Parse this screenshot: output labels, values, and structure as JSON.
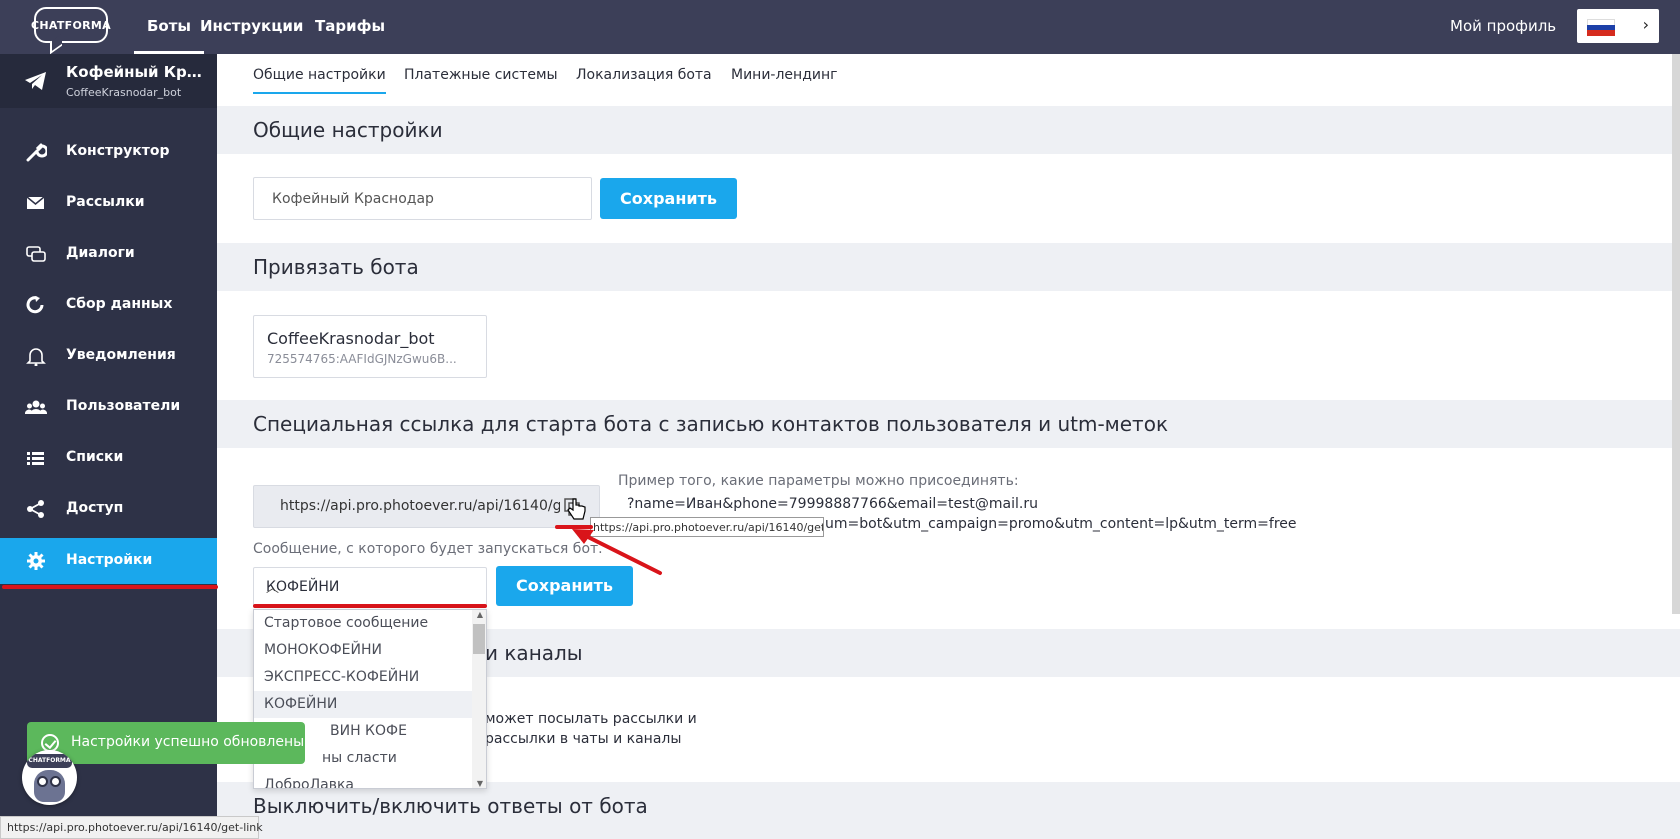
{
  "topbar": {
    "logo_text": "CHATFORMA",
    "nav": [
      {
        "label": "Боты",
        "active": true
      },
      {
        "label": "Инструкции",
        "active": false
      },
      {
        "label": "Тарифы",
        "active": false
      }
    ],
    "profile_label": "Мой профиль",
    "language_flag": "russia-flag-icon"
  },
  "sidebar": {
    "bot_name": "Кофейный Крас...",
    "bot_handle": "CoffeeKrasnodar_bot",
    "items": [
      {
        "label": "Конструктор",
        "icon": "wrench-icon"
      },
      {
        "label": "Рассылки",
        "icon": "envelope-icon"
      },
      {
        "label": "Диалоги",
        "icon": "chat-icon"
      },
      {
        "label": "Сбор данных",
        "icon": "refresh-icon"
      },
      {
        "label": "Уведомления",
        "icon": "bell-icon"
      },
      {
        "label": "Пользователи",
        "icon": "users-icon"
      },
      {
        "label": "Списки",
        "icon": "list-icon"
      },
      {
        "label": "Доступ",
        "icon": "share-icon"
      },
      {
        "label": "Настройки",
        "icon": "gear-icon",
        "active": true
      }
    ],
    "active_color": "#1aa7ec"
  },
  "tabs": [
    {
      "label": "Общие настройки",
      "active": true
    },
    {
      "label": "Платежные системы",
      "active": false
    },
    {
      "label": "Локализация бота",
      "active": false
    },
    {
      "label": "Мини-лендинг",
      "active": false
    }
  ],
  "general": {
    "heading": "Общие настройки",
    "bot_name_value": "Кофейный Краснодар",
    "save_label": "Сохранить"
  },
  "bind": {
    "heading": "Привязать бота",
    "card_title": "CoffeeKrasnodar_bot",
    "card_token": "725574765:AAFIdGJNzGwu6B..."
  },
  "special_link": {
    "heading": "Специальная ссылка для старта бота с записью контактов пользователя и utm-меток",
    "link_value": "https://api.pro.photoever.ru/api/16140/get-li",
    "tooltip": "https://api.pro.photoever.ru/api/16140/get-link",
    "example_label": "Пример того, какие параметры можно присоединять:",
    "example_line1": "?name=Иван&phone=79998887766&email=test@mail.ru",
    "example_line2": "um=bot&utm_campaign=promo&utm_content=lp&utm_term=free",
    "start_message_label": "Сообщение, с которого будет запускаться бот.",
    "selected_message": "КОФЕЙНИ",
    "save_label": "Сохранить",
    "options": [
      "Стартовое сообщение",
      "МОНОКОФЕЙНИ",
      "ЭКСПРЕСС-КОФЕЙНИ",
      "КОФЕЙНИ",
      "ВИН КОФЕ",
      "ны сласти",
      "ДоброЛавка"
    ]
  },
  "chats": {
    "heading_partial": "и каналы",
    "text_line1": "может посылать рассылки и",
    "text_line2": "рассылки в чаты и каналы"
  },
  "toggle_section": {
    "heading": "Выключить/включить ответы от бота"
  },
  "toast": {
    "message": "Настройки успешно обновлены",
    "color": "#5cb85c"
  },
  "statusbar": {
    "url": "https://api.pro.photoever.ru/api/16140/get-link"
  }
}
